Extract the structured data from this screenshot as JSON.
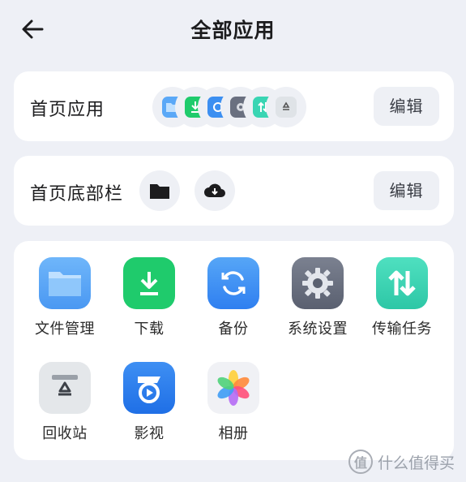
{
  "header": {
    "title": "全部应用",
    "back_icon": "arrow-left-icon"
  },
  "home_apps": {
    "label": "首页应用",
    "edit_label": "编辑",
    "mini_icons": [
      "files-icon",
      "download-icon",
      "backup-icon",
      "settings-icon",
      "transfer-icon",
      "recycle-icon"
    ]
  },
  "home_bottom_bar": {
    "label": "首页底部栏",
    "edit_label": "编辑",
    "items": [
      "folder-icon",
      "cloud-download-icon"
    ]
  },
  "apps": [
    {
      "label": "文件管理",
      "icon": "files-icon",
      "color": "#5aa8f7"
    },
    {
      "label": "下载",
      "icon": "download-icon",
      "color": "#1fcb6c"
    },
    {
      "label": "备份",
      "icon": "backup-icon",
      "color": "#3c8ff1"
    },
    {
      "label": "系统设置",
      "icon": "settings-icon",
      "color": "#6a7080"
    },
    {
      "label": "传输任务",
      "icon": "transfer-icon",
      "color": "#39d5b3"
    },
    {
      "label": "回收站",
      "icon": "recycle-icon",
      "color": "#dfe3e7"
    },
    {
      "label": "影视",
      "icon": "video-icon",
      "color": "#2f7ff0"
    },
    {
      "label": "相册",
      "icon": "photos-icon",
      "color": "#f0f1f5"
    }
  ],
  "watermark": {
    "text": "什么值得买",
    "logo": "值"
  }
}
